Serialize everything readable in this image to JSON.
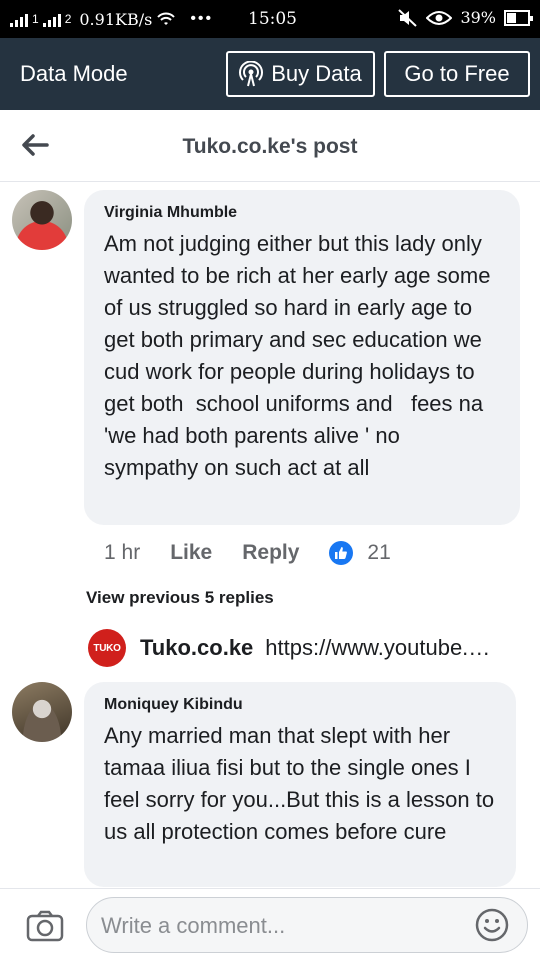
{
  "status_bar": {
    "sim1": "1",
    "sim2": "2",
    "speed": "0.91KB/s",
    "dots": "•••",
    "time": "15:05",
    "battery": "39%"
  },
  "data_bar": {
    "title": "Data Mode",
    "buy_label": "Buy Data",
    "free_label": "Go to Free"
  },
  "header": {
    "title": "Tuko.co.ke's post"
  },
  "comments": [
    {
      "author": "Virginia Mhumble",
      "text": "Am not judging either but this lady only wanted to be rich at her early age some of us struggled so hard in early age to get both primary and sec education we cud work for people during holidays to get both  school uniforms and   fees na 'we had both parents alive ' no sympathy on such act at all",
      "time": "1 hr",
      "like_label": "Like",
      "reply_label": "Reply",
      "like_count": "21"
    },
    {
      "author": "Moniquey Kibindu",
      "text": "Any married man that slept with her tamaa iliua fisi but to the single ones I feel sorry for you...But this is a lesson to us all protection comes before cure"
    }
  ],
  "replies": {
    "view_previous": "View previous 5 replies",
    "logo_text": "TUKO",
    "latest_name": "Tuko.co.ke",
    "latest_text": "https://www.youtube.com/"
  },
  "composer": {
    "placeholder": "Write a comment..."
  }
}
